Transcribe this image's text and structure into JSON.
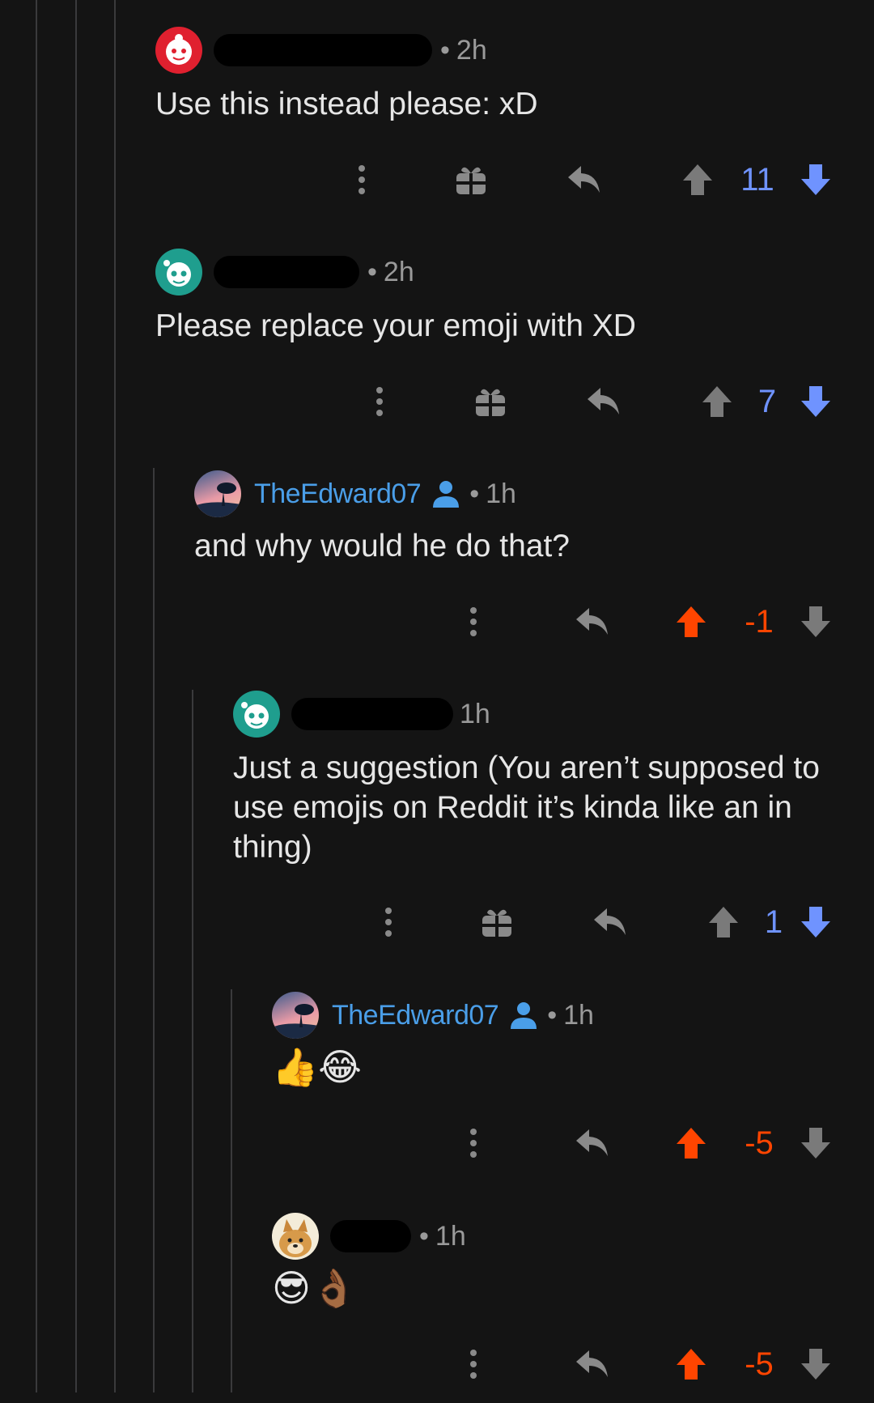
{
  "colors": {
    "background": "#141414",
    "thread_line": "#3a3a3c",
    "username": "#4a9ee8",
    "upvote": "#ff4500",
    "downvote": "#6f93ff",
    "muted": "#9a9a9a"
  },
  "comments": [
    {
      "username_redacted": true,
      "time": "2h",
      "body": "Use this instead please: xD",
      "score": "11",
      "vote": "downvoted",
      "has_award": true,
      "avatar": "red-snoo-avatar"
    },
    {
      "username_redacted": true,
      "time": "2h",
      "body": "Please replace your emoji with XD",
      "score": "7",
      "vote": "downvoted",
      "has_award": true,
      "avatar": "teal-snoo-avatar"
    },
    {
      "username": "TheEdward07",
      "is_op": true,
      "time": "1h",
      "body": "and why would he do that?",
      "score": "-1",
      "vote": "upvoted",
      "has_award": false,
      "avatar": "sunset-tree-avatar"
    },
    {
      "username_redacted": true,
      "time": "1h",
      "body": "Just a suggestion (You aren’t supposed to use emojis on Reddit it’s kinda like an in thing)",
      "score": "1",
      "vote": "downvoted",
      "has_award": true,
      "avatar": "teal-snoo-avatar"
    },
    {
      "username": "TheEdward07",
      "is_op": true,
      "time": "1h",
      "body": "👍😂",
      "score": "-5",
      "vote": "upvoted",
      "has_award": false,
      "avatar": "sunset-tree-avatar"
    },
    {
      "username_redacted": true,
      "time": "1h",
      "body": "😎👌🏾",
      "score": "-5",
      "vote": "upvoted",
      "has_award": false,
      "avatar": "doge-avatar"
    }
  ],
  "separator": "•",
  "icons": {
    "more": "more-options-icon",
    "award": "gift-award-icon",
    "reply": "reply-icon",
    "upvote": "upvote-arrow-icon",
    "downvote": "downvote-arrow-icon",
    "op": "op-person-icon"
  }
}
